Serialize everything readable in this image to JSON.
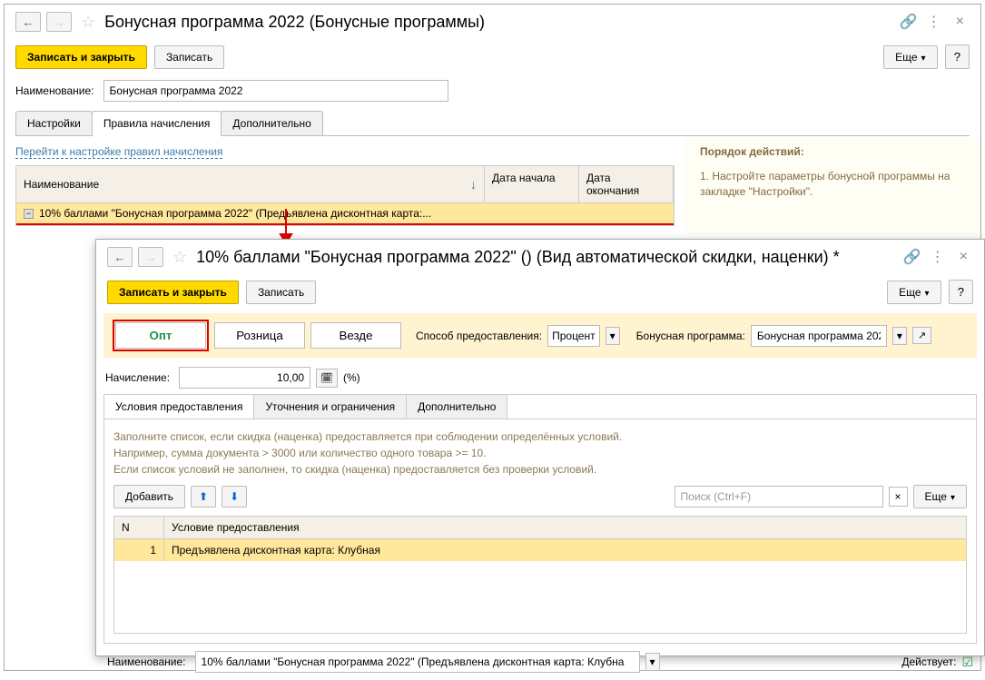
{
  "w1": {
    "title": "Бонусная программа 2022 (Бонусные программы)",
    "save_close": "Записать и закрыть",
    "save": "Записать",
    "more": "Еще",
    "help": "?",
    "name_label": "Наименование:",
    "name_value": "Бонусная программа 2022",
    "tabs": {
      "t1": "Настройки",
      "t2": "Правила начисления",
      "t3": "Дополнительно"
    },
    "link": "Перейти к настройке правил начисления",
    "cols": {
      "c1": "Наименование",
      "c2": "Дата начала",
      "c3": "Дата окончания"
    },
    "row": "10% баллами \"Бонусная программа 2022\" (Предъявлена дисконтная карта:...",
    "side_title": "Порядок действий:",
    "side_text": "1. Настройте параметры бонусной программы на закладке \"Настройки\"."
  },
  "w2": {
    "title": "10% баллами \"Бонусная программа 2022\" () (Вид автоматической скидки, наценки) *",
    "save_close": "Записать и закрыть",
    "save": "Записать",
    "more": "Еще",
    "help": "?",
    "seg": {
      "s1": "Опт",
      "s2": "Розница",
      "s3": "Везде"
    },
    "mode_label": "Способ предоставления:",
    "mode_value": "Процент",
    "prog_label": "Бонусная программа:",
    "prog_value": "Бонусная программа 202",
    "accrual_label": "Начисление:",
    "accrual_value": "10,00",
    "accrual_unit": "(%)",
    "subtabs": {
      "t1": "Условия предоставления",
      "t2": "Уточнения и ограничения",
      "t3": "Дополнительно"
    },
    "help1": "Заполните список, если скидка (наценка) предоставляется при соблюдении определённых условий.",
    "help2": "Например, сумма документа > 3000 или количество одного товара >= 10.",
    "help3": "Если список условий не заполнен, то скидка (наценка) предоставляется без проверки условий.",
    "add": "Добавить",
    "search": "Поиск (Ctrl+F)",
    "col_n": "N",
    "col_c": "Условие предоставления",
    "cond_n": "1",
    "cond_c": "Предъявлена дисконтная карта: Клубная",
    "bottom_name_label": "Наименование:",
    "bottom_name_value": "10% баллами \"Бонусная программа 2022\" (Предъявлена дисконтная карта: Клубна",
    "active_label": "Действует:"
  }
}
